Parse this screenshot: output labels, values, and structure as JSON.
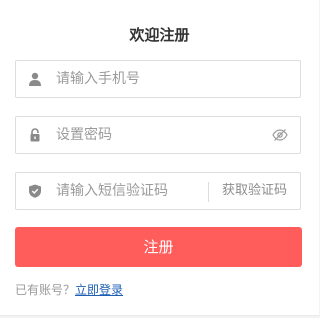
{
  "title": "欢迎注册",
  "phone": {
    "placeholder": "请输入手机号",
    "icon": "user-icon"
  },
  "password": {
    "placeholder": "设置密码",
    "icon": "lock-icon",
    "toggle_icon": "eye-off-icon"
  },
  "vcode": {
    "placeholder": "请输入短信验证码",
    "icon": "shield-icon",
    "button_label": "获取验证码"
  },
  "submit": {
    "label": "注册"
  },
  "footer": {
    "prompt": "已有账号？",
    "login_link": "立即登录"
  },
  "colors": {
    "accent": "#ff5c5c",
    "link": "#1e5fb4",
    "icon": "#8a8a8a"
  }
}
